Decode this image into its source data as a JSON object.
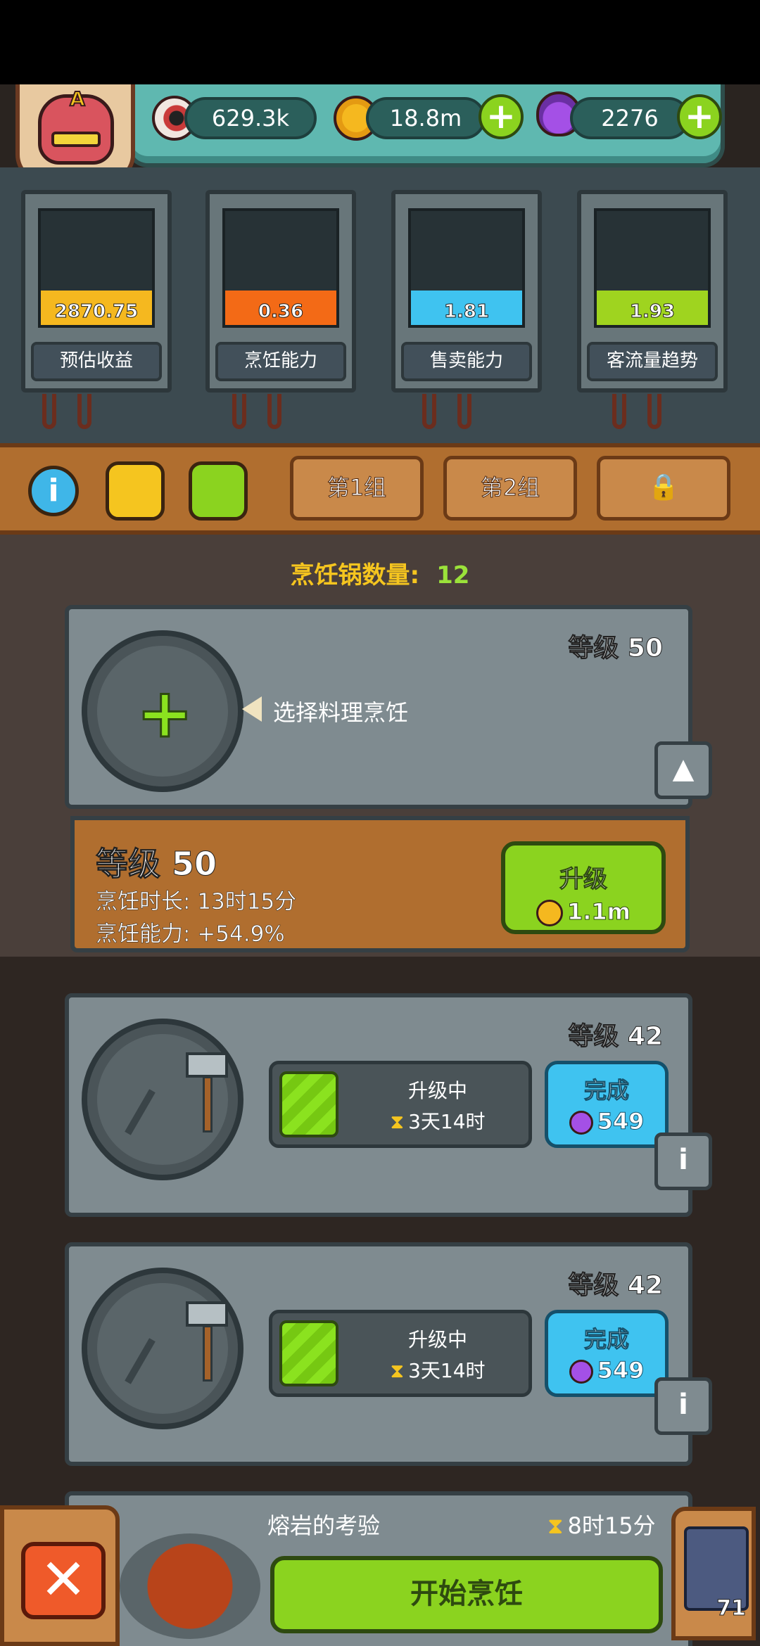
{
  "resources": {
    "eyes": "629.3k",
    "coins": "18.8m",
    "potions": "2276",
    "avatar_badge": "A"
  },
  "stats": [
    {
      "value": "2870.75",
      "label": "预估收益",
      "color": "#f5b81f",
      "fill": 0.3
    },
    {
      "value": "0.36",
      "label": "烹饪能力",
      "color": "#f36a16",
      "fill": 0.3
    },
    {
      "value": "1.81",
      "label": "售卖能力",
      "color": "#3fc3f0",
      "fill": 0.3
    },
    {
      "value": "1.93",
      "label": "客流量趋势",
      "color": "#9fd41f",
      "fill": 0.3
    }
  ],
  "tabs": {
    "info_icon": "i",
    "group1": "第1组",
    "group2": "第2组",
    "lock_icon": "lock-icon"
  },
  "pot_count": {
    "label": "烹饪锅数量:",
    "value": "12"
  },
  "card1": {
    "level": "等级 50",
    "hint": "选择料理烹饪",
    "upgrade_level": "等级 50",
    "cook_time": "烹饪时长: 13时15分",
    "cook_power": "烹饪能力: +54.9%",
    "upgrade_label": "升级",
    "upgrade_cost": "1.1m",
    "collapse_icon": "▲"
  },
  "card2": {
    "level": "等级 42",
    "status": "升级中",
    "remaining": "3天14时",
    "finish_label": "完成",
    "finish_cost": "549",
    "info_icon": "i"
  },
  "card3": {
    "level": "等级 42",
    "status": "升级中",
    "remaining": "3天14时",
    "finish_label": "完成",
    "finish_cost": "549",
    "info_icon": "i"
  },
  "quest": {
    "name": "熔岩的考验",
    "time": "8时15分",
    "start_label": "开始烹饪",
    "close_icon": "✕",
    "book_count": "71"
  }
}
